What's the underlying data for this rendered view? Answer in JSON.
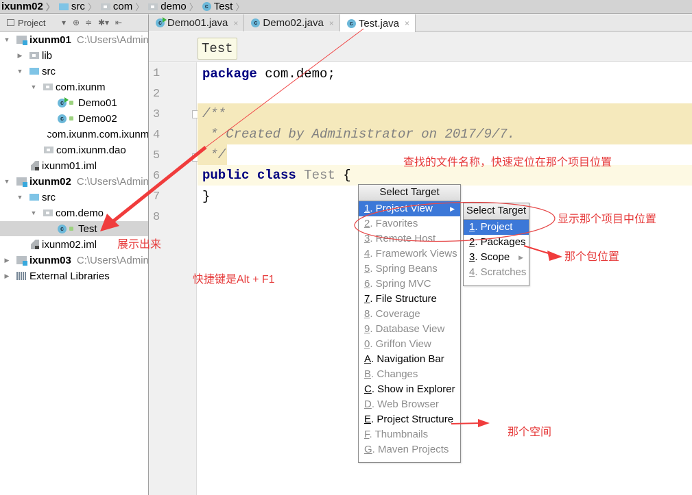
{
  "navbar": {
    "crumbs": [
      {
        "label": "ixunm02",
        "icon": "module-icon"
      },
      {
        "label": "src",
        "icon": "source-folder-icon"
      },
      {
        "label": "com",
        "icon": "package-icon"
      },
      {
        "label": "demo",
        "icon": "package-icon"
      },
      {
        "label": "Test",
        "icon": "class-icon"
      }
    ]
  },
  "project_toolbar": {
    "label": "Project",
    "tools": [
      "▾",
      "⊕",
      "≑",
      "✱▾",
      "⇤"
    ]
  },
  "tabs": [
    {
      "label": "Demo01.java",
      "icon": "runnable-class-icon",
      "close": "×",
      "active": false
    },
    {
      "label": "Demo02.java",
      "icon": "class-icon",
      "close": "×",
      "active": false
    },
    {
      "label": "Test.java",
      "icon": "class-icon",
      "close": "×",
      "active": true
    }
  ],
  "tree": {
    "nodes": [
      {
        "label": "ixunm01",
        "path": "C:\\Users\\Admin",
        "arrow": "▼",
        "type": "module"
      },
      {
        "label": "lib",
        "arrow": "▶",
        "type": "folder"
      },
      {
        "label": "src",
        "arrow": "▼",
        "type": "source"
      },
      {
        "label": "com.ixunm",
        "arrow": "▼",
        "type": "package"
      },
      {
        "label": "Demo01",
        "type": "runnable-class"
      },
      {
        "label": "Demo02",
        "type": "class"
      },
      {
        "label": "com.ixunm.com.ixunm",
        "type": "package"
      },
      {
        "label": "com.ixunm.dao",
        "type": "package"
      },
      {
        "label": "ixunm01.iml",
        "type": "iml"
      },
      {
        "label": "ixunm02",
        "path": "C:\\Users\\Admin",
        "arrow": "▼",
        "type": "module"
      },
      {
        "label": "src",
        "arrow": "▼",
        "type": "source"
      },
      {
        "label": "com.demo",
        "arrow": "▼",
        "type": "package"
      },
      {
        "label": "Test",
        "type": "class",
        "selected": true
      },
      {
        "label": "ixunm02.iml",
        "type": "iml"
      },
      {
        "label": "ixunm03",
        "path": "C:\\Users\\Admin",
        "arrow": "▶",
        "type": "module"
      },
      {
        "label": "External Libraries",
        "arrow": "▶",
        "type": "libraries"
      }
    ]
  },
  "editor": {
    "hint": "Test",
    "line_numbers": [
      "1",
      "2",
      "3",
      "4",
      "5",
      "6",
      "7",
      "8"
    ],
    "code": {
      "l1_kw": "package",
      "l1_rest": " com.demo;",
      "l3": "/**",
      "l4": " * Created by Administrator on 2017/9/7.",
      "l5": " */",
      "l6_kw1": "public",
      "l6_kw2": "class",
      "l6_name": "Test",
      "l6_rest": " {",
      "l7": "}"
    }
  },
  "select_target_menu": {
    "title": "Select Target",
    "items": [
      {
        "mn": "1",
        "label": ". Project View",
        "state": "active",
        "submenu": true
      },
      {
        "mn": "2",
        "label": ". Favorites",
        "state": "disabled"
      },
      {
        "mn": "3",
        "label": ". Remote Host",
        "state": "disabled"
      },
      {
        "mn": "4",
        "label": ". Framework Views",
        "state": "disabled"
      },
      {
        "mn": "5",
        "label": ". Spring Beans",
        "state": "disabled"
      },
      {
        "mn": "6",
        "label": ". Spring MVC",
        "state": "disabled"
      },
      {
        "mn": "7",
        "label": ". File Structure",
        "state": "enabled"
      },
      {
        "mn": "8",
        "label": ". Coverage",
        "state": "disabled"
      },
      {
        "mn": "9",
        "label": ". Database View",
        "state": "disabled"
      },
      {
        "mn": "0",
        "label": ". Griffon View",
        "state": "disabled"
      },
      {
        "mn": "A",
        "label": ". Navigation Bar",
        "state": "enabled"
      },
      {
        "mn": "B",
        "label": ". Changes",
        "state": "disabled"
      },
      {
        "mn": "C",
        "label": ". Show in Explorer",
        "state": "enabled"
      },
      {
        "mn": "D",
        "label": ". Web Browser",
        "state": "disabled"
      },
      {
        "mn": "E",
        "label": ". Project Structure",
        "state": "enabled"
      },
      {
        "mn": "F",
        "label": ". Thumbnails",
        "state": "disabled"
      },
      {
        "mn": "G",
        "label": ". Maven Projects",
        "state": "disabled"
      }
    ]
  },
  "project_view_submenu": {
    "title": "Select Target",
    "items": [
      {
        "mn": "1",
        "label": ". Project",
        "state": "active"
      },
      {
        "mn": "2",
        "label": ". Packages",
        "state": "enabled"
      },
      {
        "mn": "3",
        "label": ". Scope",
        "state": "enabled",
        "submenu": true
      },
      {
        "mn": "4",
        "label": ". Scratches",
        "state": "disabled"
      }
    ]
  },
  "annotations": {
    "shown": "展示出来",
    "find_file": "查找的文件名称，快速定位在那个项目位置",
    "project_position": "显示那个项目中位置",
    "package_position": "那个包位置",
    "shortcut": "快捷键是Alt + F1",
    "space": "那个空间",
    "color": "#e63a3a"
  }
}
